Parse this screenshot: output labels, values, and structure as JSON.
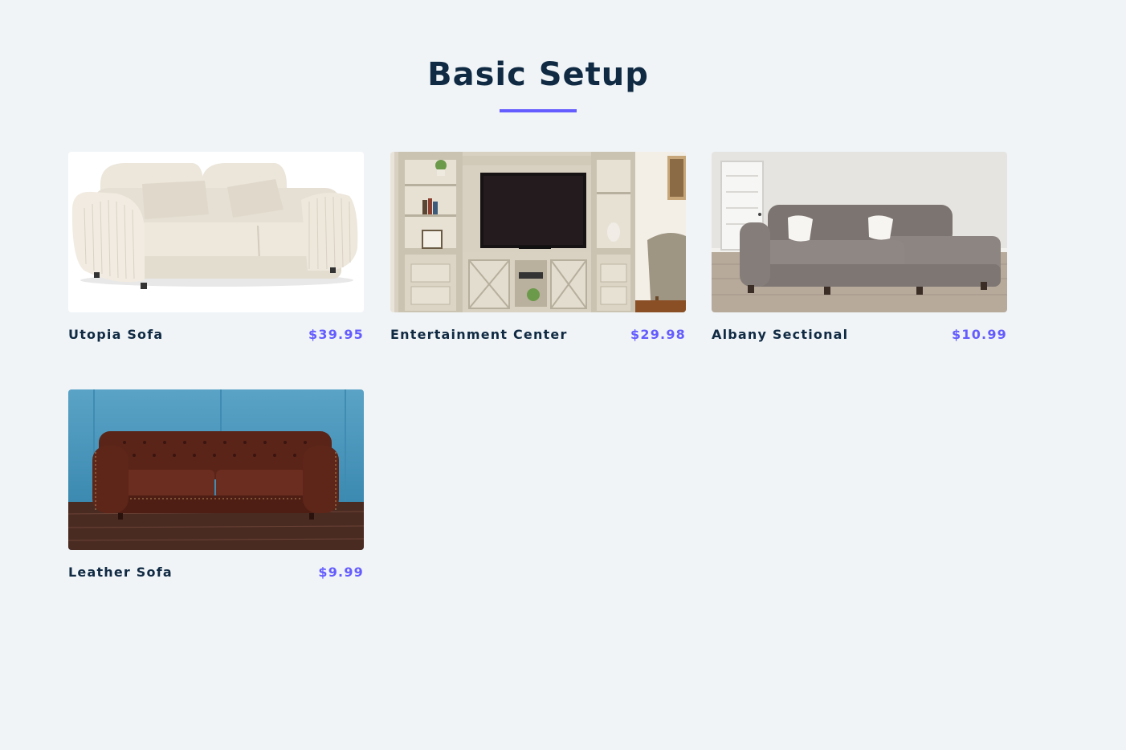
{
  "page": {
    "title": "Basic Setup",
    "accent_color": "#645cff",
    "text_color": "#102a43",
    "background_color": "#f0f4f7"
  },
  "products": [
    {
      "name": "Utopia Sofa",
      "price": "$39.95",
      "image": "cream-corduroy-sofa"
    },
    {
      "name": "Entertainment Center",
      "price": "$29.98",
      "image": "tv-entertainment-unit"
    },
    {
      "name": "Albany Sectional",
      "price": "$10.99",
      "image": "grey-sectional-sofa"
    },
    {
      "name": "Leather Sofa",
      "price": "$9.99",
      "image": "brown-leather-chesterfield"
    }
  ]
}
